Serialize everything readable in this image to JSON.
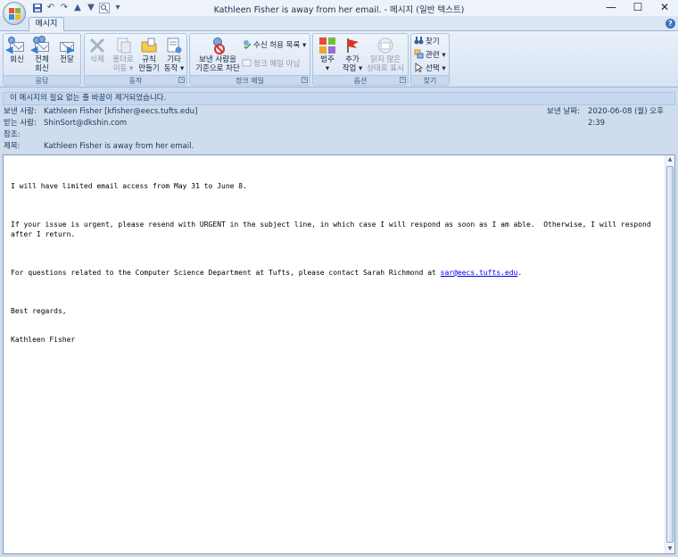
{
  "window": {
    "title": "Kathleen Fisher is away from her email. - 메시지 (일반 텍스트)",
    "controls": {
      "minimize": "—",
      "maximize": "☐",
      "close": "✕"
    }
  },
  "quick_access": [
    "save-icon",
    "undo-icon",
    "redo-icon",
    "up-icon",
    "down-icon",
    "find-icon",
    "customize-icon"
  ],
  "tabs": [
    {
      "label": "메시지",
      "active": true
    }
  ],
  "help_label": "?",
  "ribbon": {
    "groups": {
      "respond": {
        "label": "응답",
        "reply": "회신",
        "reply_all_line1": "전체",
        "reply_all_line2": "회신",
        "forward": "전달"
      },
      "actions": {
        "label": "동작",
        "delete": "삭제",
        "move_line1": "폴더로",
        "move_line2": "이동 ▾",
        "rules_line1": "규칙",
        "rules_line2": "만들기 ▾",
        "other_line1": "기타",
        "other_line2": "동작 ▾"
      },
      "junk": {
        "label": "정크 메일",
        "block_line1": "보낸 사람을",
        "block_line2": "기준으로 차단",
        "safe_list": "수신 허용 목록 ▾",
        "not_junk": "정크 메일 아님"
      },
      "options": {
        "label": "옵션",
        "categorize_line1": "범주",
        "categorize_line2": "▾",
        "followup_line1": "추가",
        "followup_line2": "작업 ▾",
        "unread_line1": "읽지 않은",
        "unread_line2": "상태로 표시"
      },
      "find": {
        "label": "찾기",
        "find": "찾기",
        "related": "관련 ▾",
        "select": "선택 ▾"
      }
    },
    "colors": {
      "accent": "#3d72c7",
      "group_label_bg": "#c8d8ee"
    }
  },
  "infobar": "이 메시지의 필요 없는 줄 바꿈이 제거되었습니다.",
  "header": {
    "from_label": "보낸 사람:",
    "from_value": "Kathleen Fisher [kfisher@eecs.tufts.edu]",
    "to_label": "받는 사람:",
    "to_value": "ShinSort@dkshin.com",
    "cc_label": "참조:",
    "cc_value": "",
    "subject_label": "제목:",
    "subject_value": "Kathleen Fisher is away from her email.",
    "sent_label": "보낸 날짜:",
    "sent_value": "2020-06-08 (월) 오후 2:39"
  },
  "body": {
    "line1": "I will have limited email access from May 31 to June 8.",
    "line2": "If your issue is urgent, please resend with URGENT in the subject line, in which case I will respond as soon as I am able.  Otherwise, I will respond after I return.",
    "line3_prefix": "For questions related to the Computer Science Department at Tufts, please contact Sarah Richmond at ",
    "line3_link": "sar@eecs.tufts.edu",
    "line3_suffix": ".",
    "closing": "Best regards,",
    "signature": "Kathleen Fisher"
  }
}
